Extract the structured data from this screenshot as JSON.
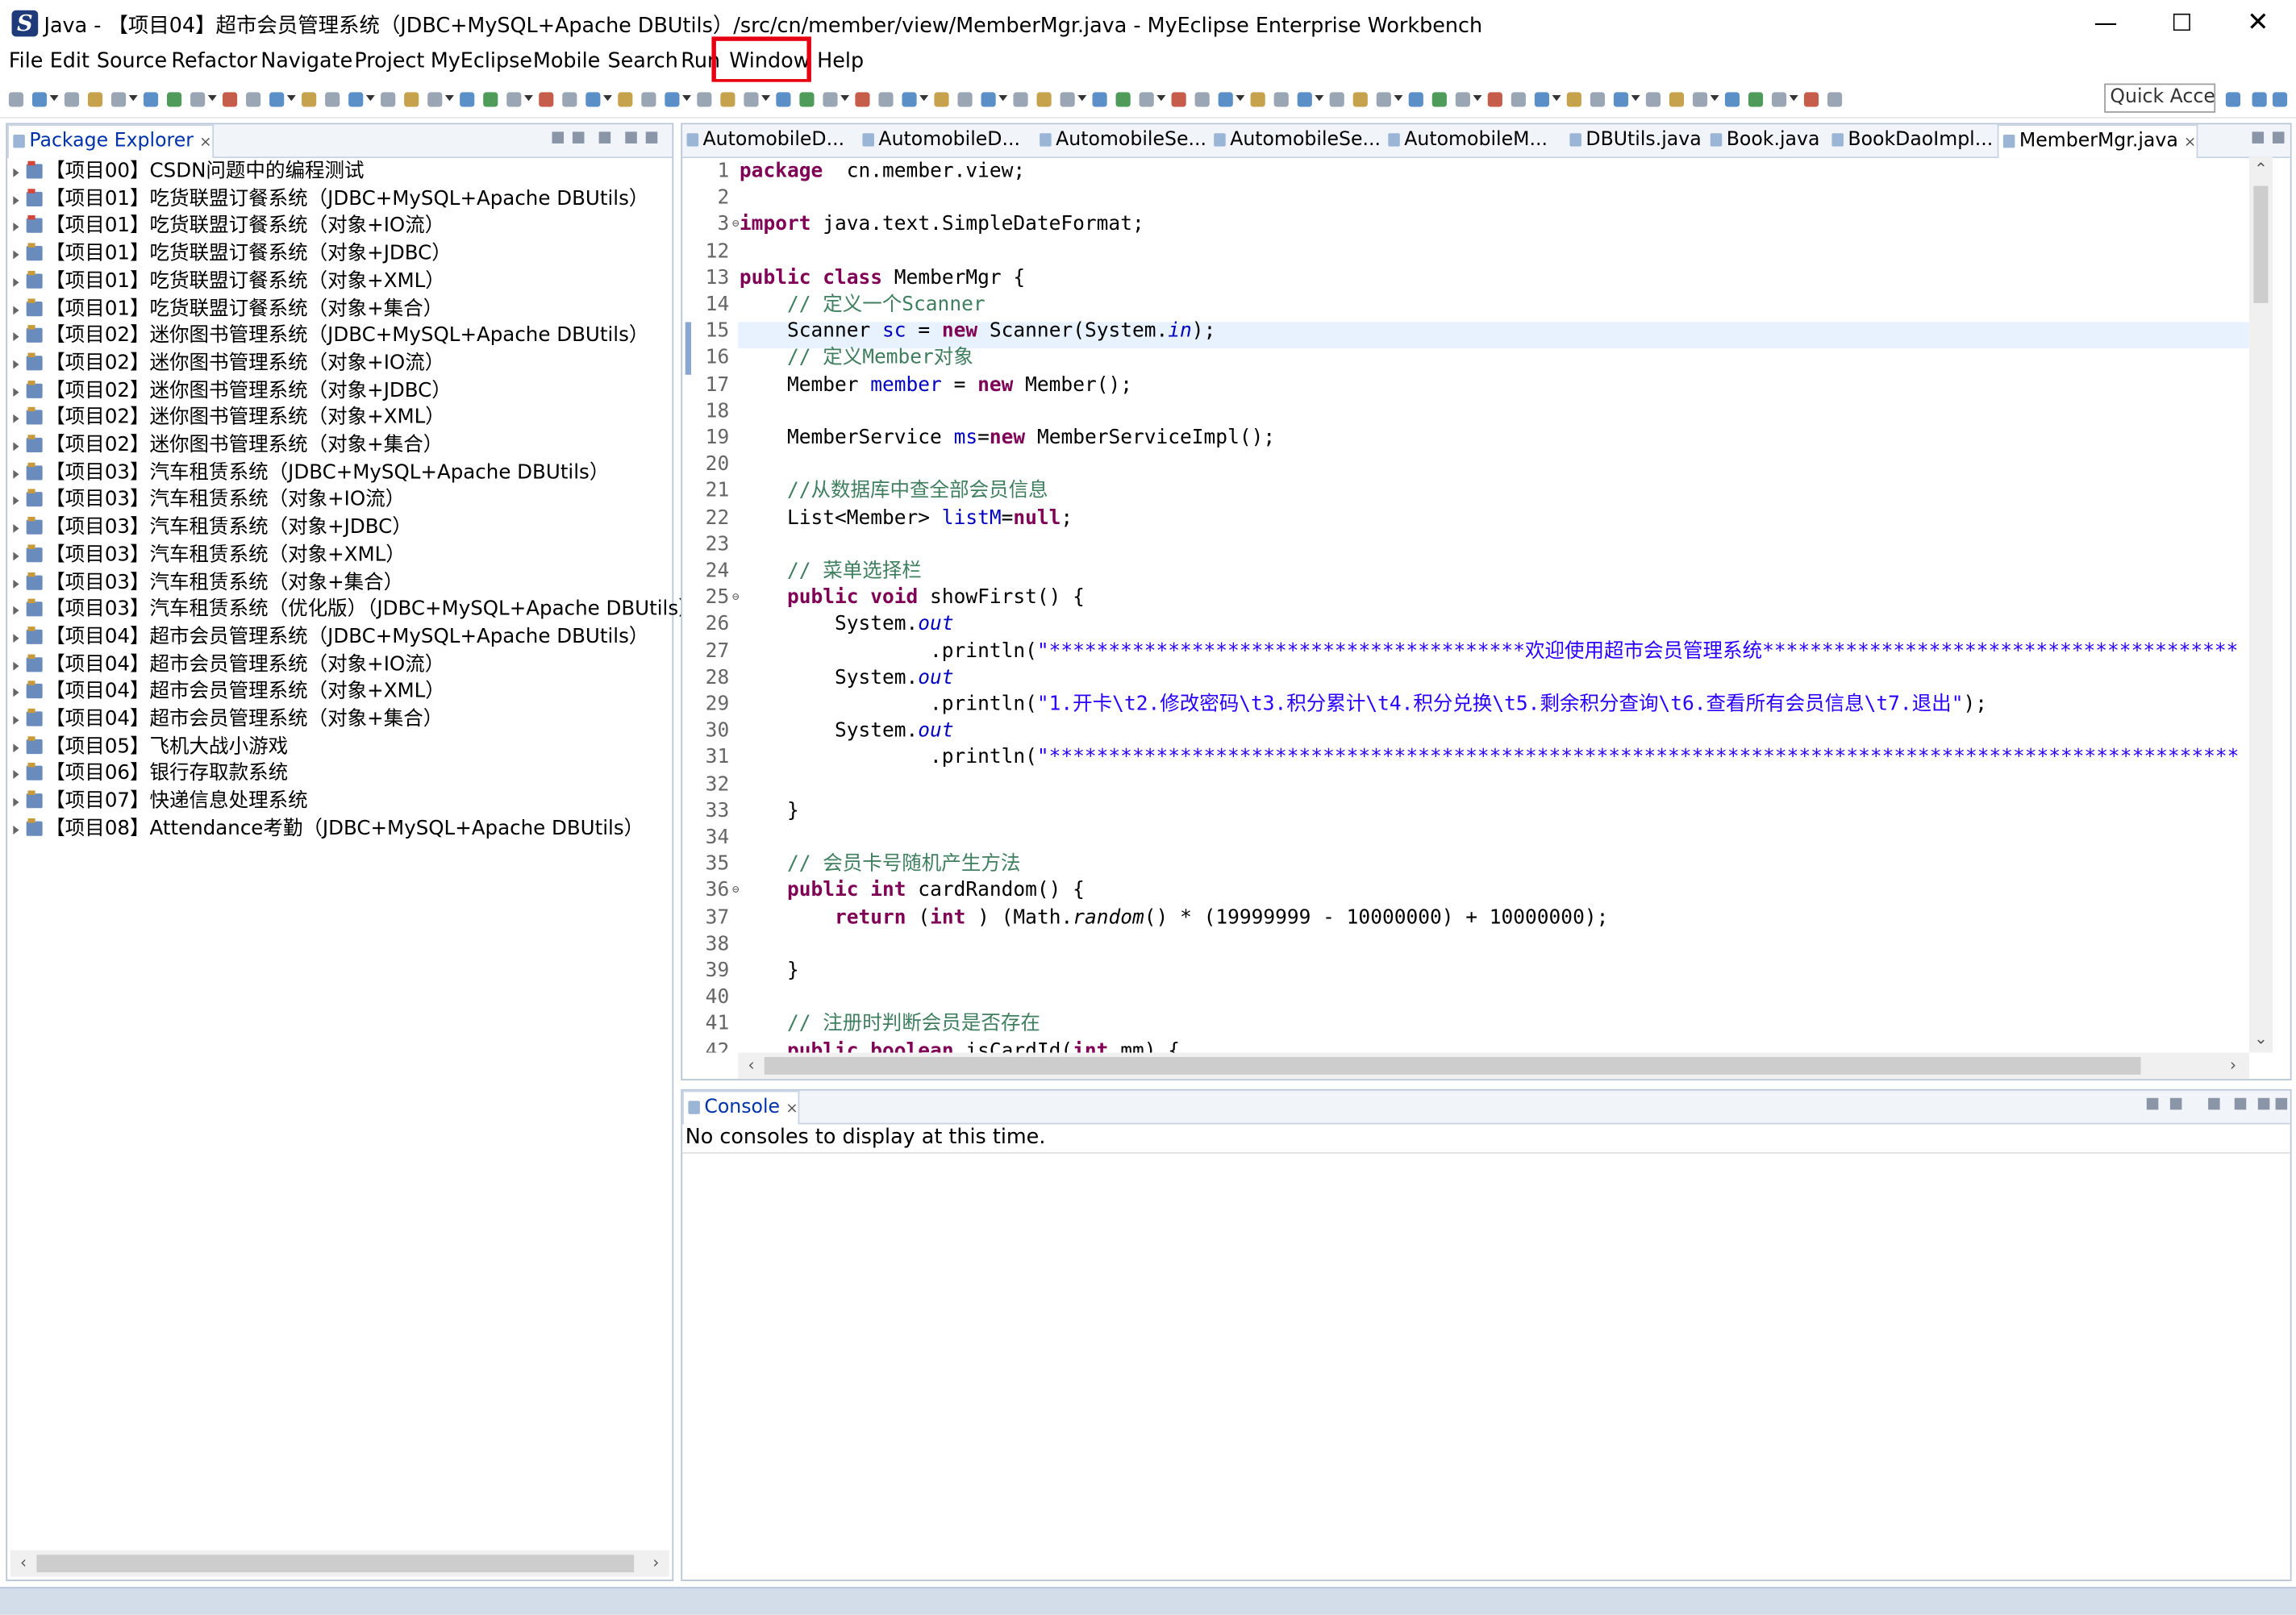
{
  "window": {
    "title": "Java - 【项目04】超市会员管理系统（JDBC+MySQL+Apache DBUtils）/src/cn/member/view/MemberMgr.java - MyEclipse Enterprise Workbench",
    "logo_glyph": "S",
    "minimize_glyph": "—",
    "maximize_glyph": "☐",
    "close_glyph": "✕"
  },
  "menu": [
    "File",
    "Edit",
    "Source",
    "Refactor",
    "Navigate",
    "Project",
    "MyEclipse",
    "Mobile",
    "Search",
    "Run",
    "Window",
    "Help"
  ],
  "highlight_color": "#e60012",
  "toolbar": {
    "quick_access": "Quick Acce"
  },
  "package_explorer": {
    "title": "Package Explorer",
    "close_glyph": "×",
    "projects": [
      "【项目00】CSDN问题中的编程测试",
      "【项目01】吃货联盟订餐系统（JDBC+MySQL+Apache DBUtils）",
      "【项目01】吃货联盟订餐系统（对象+IO流）",
      "【项目01】吃货联盟订餐系统（对象+JDBC）",
      "【项目01】吃货联盟订餐系统（对象+XML）",
      "【项目01】吃货联盟订餐系统（对象+集合）",
      "【项目02】迷你图书管理系统（JDBC+MySQL+Apache DBUtils）",
      "【项目02】迷你图书管理系统（对象+IO流）",
      "【项目02】迷你图书管理系统（对象+JDBC）",
      "【项目02】迷你图书管理系统（对象+XML）",
      "【项目02】迷你图书管理系统（对象+集合）",
      "【项目03】汽车租赁系统（JDBC+MySQL+Apache DBUtils）",
      "【项目03】汽车租赁系统（对象+IO流）",
      "【项目03】汽车租赁系统（对象+JDBC）",
      "【项目03】汽车租赁系统（对象+XML）",
      "【项目03】汽车租赁系统（对象+集合）",
      "【项目03】汽车租赁系统（优化版）（JDBC+MySQL+Apache DBUtils）",
      "【项目04】超市会员管理系统（JDBC+MySQL+Apache DBUtils）",
      "【项目04】超市会员管理系统（对象+IO流）",
      "【项目04】超市会员管理系统（对象+XML）",
      "【项目04】超市会员管理系统（对象+集合）",
      "【项目05】飞机大战小游戏",
      "【项目06】银行存取款系统",
      "【项目07】快递信息处理系统",
      "【项目08】Attendance考勤（JDBC+MySQL+Apache DBUtils）"
    ]
  },
  "editor": {
    "tabs": [
      "AutomobileD...",
      "AutomobileD...",
      "AutomobileSe...",
      "AutomobileSe...",
      "AutomobileM...",
      "DBUtils.java",
      "Book.java",
      "BookDaoImpl...",
      "MemberMgr.java"
    ],
    "active_tab": "MemberMgr.java",
    "close_glyph": "×",
    "fold_glyph": "⊖",
    "arrow_glyphs": {
      "up": "⌃",
      "down": "⌄",
      "left": "‹",
      "right": "›"
    },
    "lines": [
      {
        "n": "1",
        "segs": [
          [
            "kw",
            "package"
          ],
          [
            "",
            "  cn.member.view;"
          ]
        ]
      },
      {
        "n": "2",
        "segs": []
      },
      {
        "n": "3",
        "segs": [
          [
            "kw",
            "import"
          ],
          [
            "",
            " java.text.SimpleDateFormat;"
          ]
        ]
      },
      {
        "n": "12",
        "segs": []
      },
      {
        "n": "13",
        "segs": [
          [
            "kw",
            "public class"
          ],
          [
            "",
            " MemberMgr {"
          ]
        ]
      },
      {
        "n": "14",
        "segs": [
          [
            "",
            "    "
          ],
          [
            "cm",
            "// 定义一个Scanner"
          ]
        ]
      },
      {
        "n": "15",
        "segs": [
          [
            "",
            "    Scanner "
          ],
          [
            "fld",
            "sc"
          ],
          [
            "",
            " = "
          ],
          [
            "kw",
            "new"
          ],
          [
            "",
            " Scanner(System."
          ],
          [
            "sfld",
            "in"
          ],
          [
            "",
            ");"
          ]
        ]
      },
      {
        "n": "16",
        "segs": [
          [
            "",
            "    "
          ],
          [
            "cm",
            "// 定义Member对象"
          ]
        ]
      },
      {
        "n": "17",
        "segs": [
          [
            "",
            "    Member "
          ],
          [
            "fld",
            "member"
          ],
          [
            "",
            " = "
          ],
          [
            "kw",
            "new"
          ],
          [
            "",
            " Member();"
          ]
        ]
      },
      {
        "n": "18",
        "segs": []
      },
      {
        "n": "19",
        "segs": [
          [
            "",
            "    MemberService "
          ],
          [
            "fld",
            "ms"
          ],
          [
            "",
            "="
          ],
          [
            "kw",
            "new"
          ],
          [
            "",
            " MemberServiceImpl();"
          ]
        ]
      },
      {
        "n": "20",
        "segs": []
      },
      {
        "n": "21",
        "segs": [
          [
            "",
            "    "
          ],
          [
            "cm",
            "//从数据库中查全部会员信息"
          ]
        ]
      },
      {
        "n": "22",
        "segs": [
          [
            "",
            "    List<Member> "
          ],
          [
            "fld",
            "listM"
          ],
          [
            "",
            "="
          ],
          [
            "kw",
            "null"
          ],
          [
            "",
            ";"
          ]
        ]
      },
      {
        "n": "23",
        "segs": []
      },
      {
        "n": "24",
        "segs": [
          [
            "",
            "    "
          ],
          [
            "cm",
            "// 菜单选择栏"
          ]
        ]
      },
      {
        "n": "25",
        "segs": [
          [
            "",
            "    "
          ],
          [
            "kw",
            "public void"
          ],
          [
            "",
            " showFirst() {"
          ]
        ]
      },
      {
        "n": "26",
        "segs": [
          [
            "",
            "        System."
          ],
          [
            "sfld",
            "out"
          ]
        ]
      },
      {
        "n": "27",
        "segs": [
          [
            "",
            "                .println("
          ],
          [
            "str",
            "\"****************************************欢迎使用超市会员管理系统****************************************"
          ]
        ]
      },
      {
        "n": "28",
        "segs": [
          [
            "",
            "        System."
          ],
          [
            "sfld",
            "out"
          ]
        ]
      },
      {
        "n": "29",
        "segs": [
          [
            "",
            "                .println("
          ],
          [
            "str",
            "\"1.开卡\\t2.修改密码\\t3.积分累计\\t4.积分兑换\\t5.剩余积分查询\\t6.查看所有会员信息\\t7.退出\""
          ],
          [
            "",
            ");"
          ]
        ]
      },
      {
        "n": "30",
        "segs": [
          [
            "",
            "        System."
          ],
          [
            "sfld",
            "out"
          ]
        ]
      },
      {
        "n": "31",
        "segs": [
          [
            "",
            "                .println("
          ],
          [
            "str",
            "\"****************************************************************************************************"
          ]
        ]
      },
      {
        "n": "32",
        "segs": []
      },
      {
        "n": "33",
        "segs": [
          [
            "",
            "    }"
          ]
        ]
      },
      {
        "n": "34",
        "segs": []
      },
      {
        "n": "35",
        "segs": [
          [
            "",
            "    "
          ],
          [
            "cm",
            "// 会员卡号随机产生方法"
          ]
        ]
      },
      {
        "n": "36",
        "segs": [
          [
            "",
            "    "
          ],
          [
            "kw",
            "public int"
          ],
          [
            "",
            " cardRandom() {"
          ]
        ]
      },
      {
        "n": "37",
        "segs": [
          [
            "",
            "        "
          ],
          [
            "kw",
            "return"
          ],
          [
            "",
            " ("
          ],
          [
            "kw",
            "int"
          ],
          [
            "",
            " ) (Math."
          ],
          [
            "smth",
            "random"
          ],
          [
            "",
            "() * (19999999 - 10000000) + 10000000);"
          ]
        ]
      },
      {
        "n": "38",
        "segs": []
      },
      {
        "n": "39",
        "segs": [
          [
            "",
            "    }"
          ]
        ]
      },
      {
        "n": "40",
        "segs": []
      },
      {
        "n": "41",
        "segs": [
          [
            "",
            "    "
          ],
          [
            "cm",
            "// 注册时判断会员是否存在"
          ]
        ]
      },
      {
        "n": "42",
        "segs": [
          [
            "",
            "    "
          ],
          [
            "kw",
            "public boolean"
          ],
          [
            "",
            " isCardId("
          ],
          [
            "kw",
            "int"
          ],
          [
            "",
            " mm) {"
          ]
        ]
      }
    ]
  },
  "console": {
    "title": "Console",
    "close_glyph": "×",
    "message": "No consoles to display at this time."
  }
}
